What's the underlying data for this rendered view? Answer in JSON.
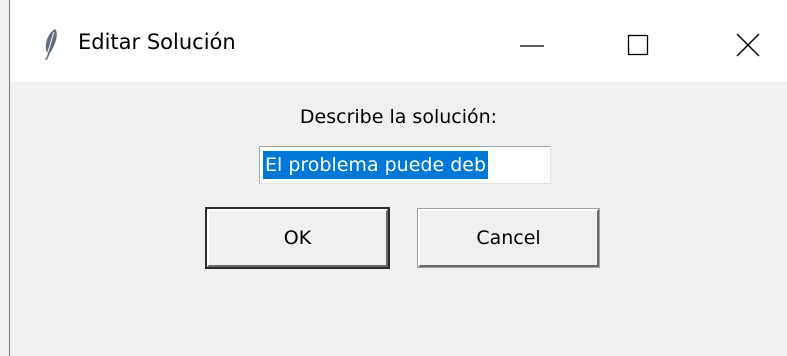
{
  "window": {
    "title": "Editar Solución",
    "title_icon": "feather-icon",
    "controls": [
      "minimize-icon",
      "maximize-icon",
      "close-icon"
    ]
  },
  "dialog": {
    "prompt": "Describe la solución:",
    "entry_value": "El problema puede deb",
    "ok_label": "OK",
    "cancel_label": "Cancel"
  },
  "colors": {
    "selection": "#0078d7",
    "client_bg": "#f0f0f0",
    "titlebar_bg": "#ffffff"
  }
}
